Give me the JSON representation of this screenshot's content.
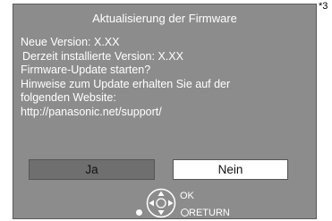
{
  "footnote": "*3",
  "dialog": {
    "title": "Aktualisierung der Firmware",
    "lines": [
      "Neue Version:  X.XX",
      "Derzeit installierte Version:  X.XX",
      "Firmware-Update starten?",
      "Hinweise zum Update erhalten Sie auf der",
      "folgenden Website:",
      "http://panasonic.net/support/"
    ],
    "buttons": {
      "yes_label": "Ja",
      "no_label": "Nein"
    },
    "remote_hints": {
      "ok_label": "OK",
      "return_label": "RETURN"
    }
  },
  "colors": {
    "dialog_bg": "#8c8c8c",
    "yes_button_bg": "#6f6f6f",
    "no_button_bg": "#ffffff"
  }
}
